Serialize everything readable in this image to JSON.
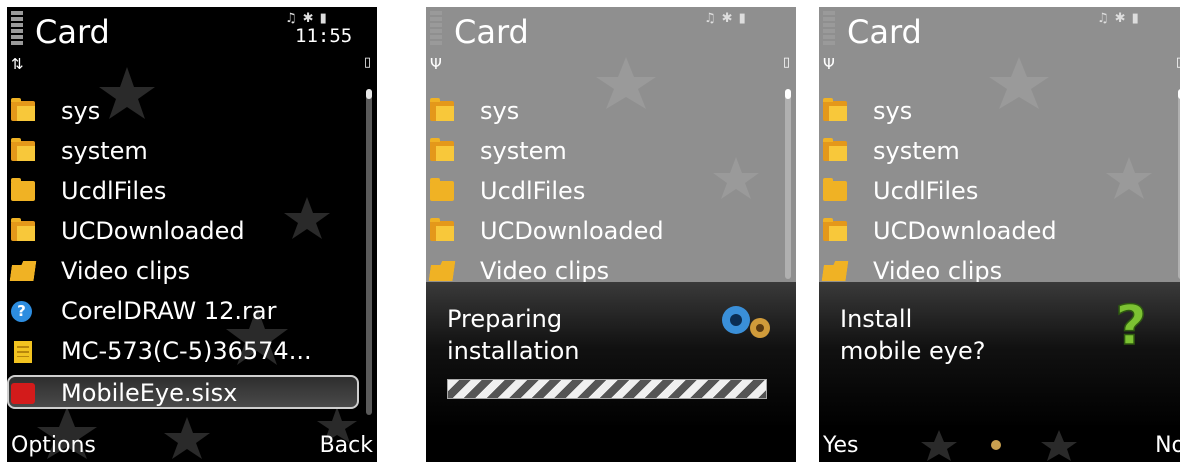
{
  "colors": {
    "folder": "#f0b224",
    "info": "#2d8de0",
    "sisx": "#d31b1b",
    "background": "#000000",
    "overlay": "#8f8f8f"
  },
  "screens": [
    {
      "title": "Card",
      "clock": "11:55",
      "softkeys": {
        "left": "Options",
        "right": "Back"
      },
      "items": [
        {
          "label": "sys",
          "icon": "folder-stack-icon"
        },
        {
          "label": "system",
          "icon": "folder-stack-icon"
        },
        {
          "label": "UcdlFiles",
          "icon": "folder-icon"
        },
        {
          "label": "UCDownloaded",
          "icon": "folder-stack-icon"
        },
        {
          "label": "Video clips",
          "icon": "folder-open-icon"
        },
        {
          "label": "CorelDRAW 12.rar",
          "icon": "question-icon"
        },
        {
          "label": "MC-573(C-5)36574...",
          "icon": "document-icon"
        },
        {
          "label": "MobileEye.sisx",
          "icon": "sisx-icon",
          "selected": true
        }
      ]
    },
    {
      "title": "Card",
      "items": [
        {
          "label": "sys",
          "icon": "folder-stack-icon"
        },
        {
          "label": "system",
          "icon": "folder-stack-icon"
        },
        {
          "label": "UcdlFiles",
          "icon": "folder-icon"
        },
        {
          "label": "UCDownloaded",
          "icon": "folder-stack-icon"
        },
        {
          "label": "Video clips",
          "icon": "folder-open-icon"
        }
      ],
      "dialog": {
        "line1": "Preparing",
        "line2": "installation",
        "icon": "gears-icon"
      }
    },
    {
      "title": "Card",
      "items": [
        {
          "label": "sys",
          "icon": "folder-stack-icon"
        },
        {
          "label": "system",
          "icon": "folder-stack-icon"
        },
        {
          "label": "UcdlFiles",
          "icon": "folder-icon"
        },
        {
          "label": "UCDownloaded",
          "icon": "folder-stack-icon"
        },
        {
          "label": "Video clips",
          "icon": "folder-open-icon"
        }
      ],
      "dialog": {
        "line1": "Install",
        "line2": "mobile eye?",
        "icon": "question-mark-icon"
      },
      "softkeys": {
        "left": "Yes",
        "right": "No"
      }
    }
  ]
}
